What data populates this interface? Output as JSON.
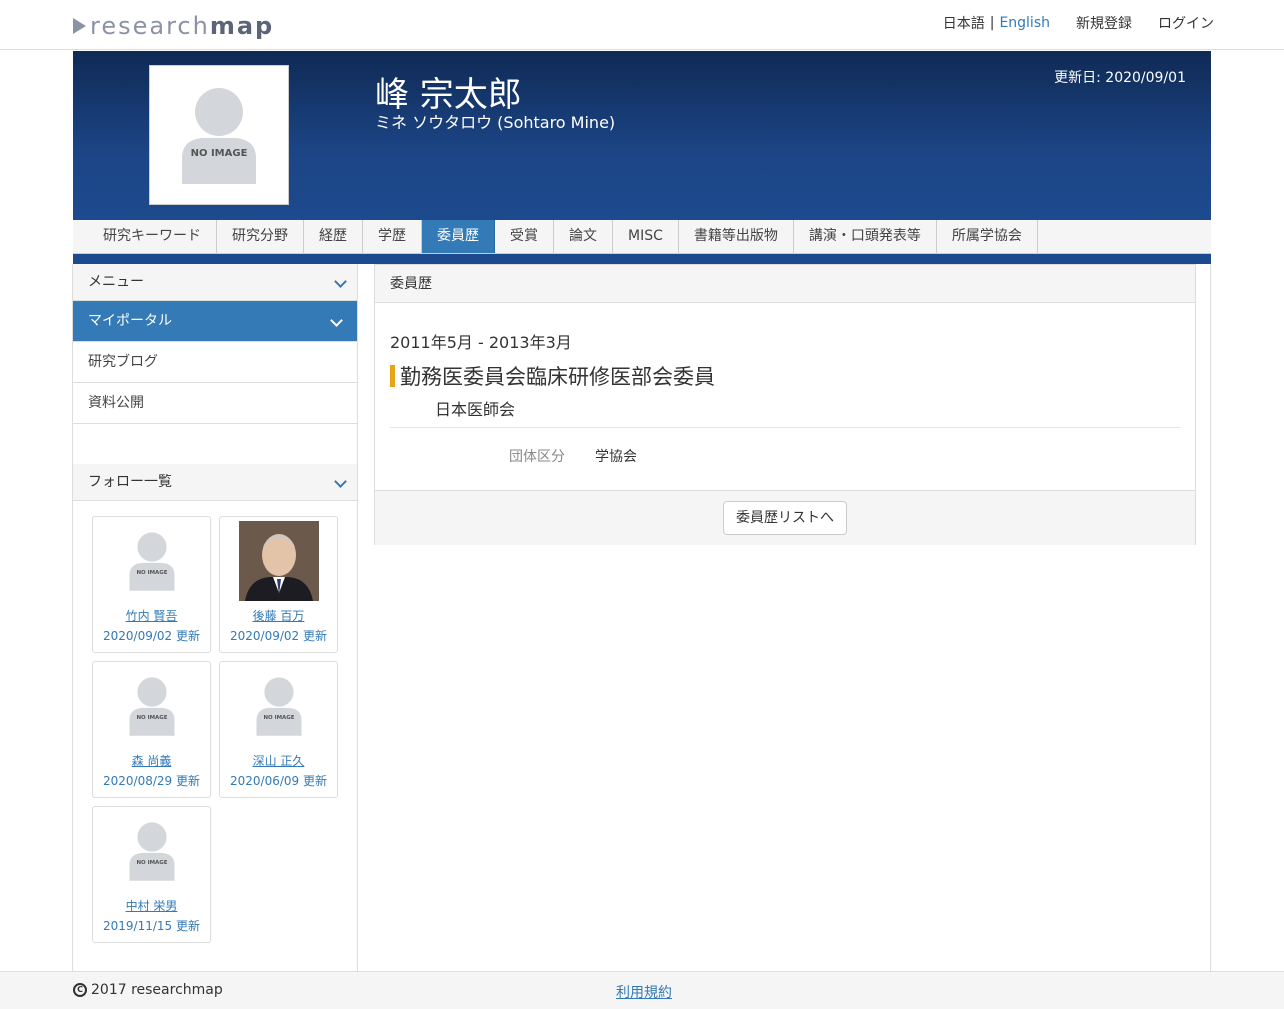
{
  "header": {
    "logo_light": "research",
    "logo_bold": "map",
    "lang_ja": "日本語",
    "lang_sep": "|",
    "lang_en": "English",
    "register": "新規登録",
    "login": "ログイン"
  },
  "profile": {
    "name": "峰 宗太郎",
    "kana": "ミネ ソウタロウ  (Sohtaro Mine)",
    "updated": "更新日: 2020/09/01",
    "no_image": "NO IMAGE"
  },
  "tabs": [
    {
      "label": "研究キーワード",
      "active": false
    },
    {
      "label": "研究分野",
      "active": false
    },
    {
      "label": "経歴",
      "active": false
    },
    {
      "label": "学歴",
      "active": false
    },
    {
      "label": "委員歴",
      "active": true
    },
    {
      "label": "受賞",
      "active": false
    },
    {
      "label": "論文",
      "active": false
    },
    {
      "label": "MISC",
      "active": false
    },
    {
      "label": "書籍等出版物",
      "active": false
    },
    {
      "label": "講演・口頭発表等",
      "active": false
    },
    {
      "label": "所属学協会",
      "active": false
    }
  ],
  "sidebar": {
    "menu_title": "メニュー",
    "items": [
      {
        "label": "マイポータル"
      },
      {
        "label": "研究ブログ"
      },
      {
        "label": "資料公開"
      }
    ],
    "follow_title": "フォロー一覧",
    "follows": [
      {
        "name": "竹内 賢吾",
        "date": "2020/09/02 更新"
      },
      {
        "name": "後藤 百万",
        "date": "2020/09/02 更新"
      },
      {
        "name": "森 尚義",
        "date": "2020/08/29 更新"
      },
      {
        "name": "深山 正久",
        "date": "2020/06/09 更新"
      },
      {
        "name": "中村 栄男",
        "date": "2019/11/15 更新"
      }
    ]
  },
  "main": {
    "section_title": "委員歴",
    "period": "2011年5月 - 2013年3月",
    "title": "勤務医委員会臨床研修医部会委員",
    "organization": "日本医師会",
    "field_label": "団体区分",
    "field_value": "学協会",
    "back_button": "委員歴リストへ"
  },
  "footer": {
    "copyright": "2017 researchmap",
    "terms": "利用規約"
  },
  "colors": {
    "accent": "#337ab7",
    "banner": "#1d4a8e",
    "title_bar": "#e8a317"
  }
}
